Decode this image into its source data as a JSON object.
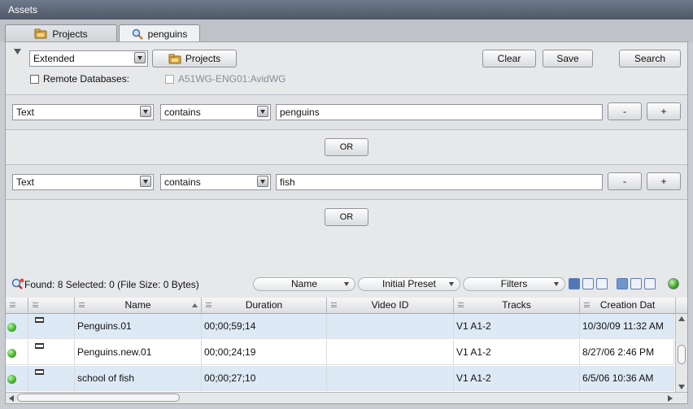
{
  "window": {
    "title": "Assets"
  },
  "tabs": [
    {
      "label": "Projects",
      "icon": "projects-folder-icon"
    },
    {
      "label": "penguins",
      "icon": "search-icon"
    }
  ],
  "query": {
    "mode": "Extended",
    "projects_button": "Projects",
    "clear_button": "Clear",
    "save_button": "Save",
    "search_button": "Search",
    "remote_label": "Remote Databases:",
    "remote_db": "A51WG-ENG01:AvidWG",
    "remote_checked": false
  },
  "criteria": [
    {
      "field": "Text",
      "operator": "contains",
      "value": "penguins",
      "minus": "-",
      "plus": "+"
    },
    {
      "field": "Text",
      "operator": "contains",
      "value": "fish",
      "minus": "-",
      "plus": "+"
    }
  ],
  "or_label": "OR",
  "results": {
    "summary": "Found: 8 Selected: 0 (File Size: 0 Bytes)",
    "sort_by": "Name",
    "preset": "Initial Preset",
    "filters": "Filters"
  },
  "columns": [
    "Name",
    "Duration",
    "Video ID",
    "Tracks",
    "Creation Dat"
  ],
  "rows": [
    {
      "name": "Penguins.01",
      "duration": "00;00;59;14",
      "video_id": "",
      "tracks": "V1 A1-2",
      "created": "10/30/09 11:32 AM"
    },
    {
      "name": "Penguins.new.01",
      "duration": "00;00;24;19",
      "video_id": "",
      "tracks": "V1 A1-2",
      "created": "8/27/06 2:46 PM"
    },
    {
      "name": "school of fish",
      "duration": "00;00;27;10",
      "video_id": "",
      "tracks": "V1 A1-2",
      "created": "6/5/06 10:36 AM"
    }
  ],
  "colors": {
    "titlebar": "#4e5866",
    "accent_blue": "#5a7db0",
    "online_green": "#3fae2a",
    "row_alt": "#dde9f5"
  }
}
